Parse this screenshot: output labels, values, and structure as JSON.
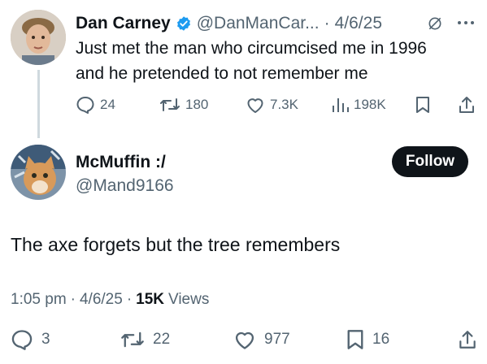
{
  "parent_tweet": {
    "display_name": "Dan Carney",
    "handle": "@DanManCar...",
    "separator": "·",
    "date": "4/6/25",
    "text_line1": "Just met the man who circumcised me in 1996",
    "text_line2": "and he pretended to not remember me",
    "stats": {
      "replies": "24",
      "reposts": "180",
      "likes": "7.3K",
      "views": "198K"
    }
  },
  "reply_tweet": {
    "display_name": "McMuffin :/",
    "handle": "@Mand9166",
    "follow_label": "Follow",
    "text": "The axe forgets but the tree remembers",
    "meta": {
      "time": "1:05 pm",
      "dot1": "·",
      "date": "4/6/25",
      "dot2": "·",
      "views_count": "15K",
      "views_label": "Views"
    },
    "stats": {
      "replies": "3",
      "reposts": "22",
      "likes": "977",
      "bookmarks": "16"
    }
  },
  "colors": {
    "verified_badge": "#1d9bf0",
    "text": "#0f1419",
    "muted": "#536471",
    "thread_line": "#cfd9de"
  },
  "icons": [
    "verified-icon",
    "grok-icon",
    "more-icon",
    "reply-icon",
    "repost-icon",
    "like-icon",
    "views-icon",
    "bookmark-icon",
    "share-icon"
  ]
}
